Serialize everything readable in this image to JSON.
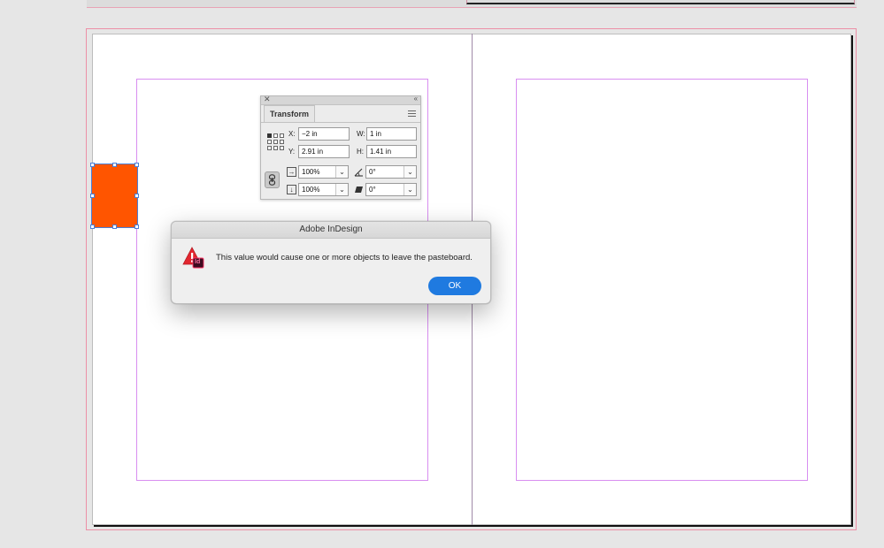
{
  "transform_panel": {
    "tab_label": "Transform",
    "close_glyph": "✕",
    "collapse_glyph": "‹‹",
    "x_label": "X:",
    "x_value": "−2 in",
    "y_label": "Y:",
    "y_value": "2.91 in",
    "w_label": "W:",
    "w_value": "1 in",
    "h_label": "H:",
    "h_value": "1.41 in",
    "scale_x_value": "100%",
    "scale_y_value": "100%",
    "rotation_value": "0°",
    "shear_value": "0°",
    "icons": {
      "reference_point": "reference-point-grid-icon",
      "constrain": "chain-link-icon",
      "scale_x": "scale-x-icon",
      "scale_y": "scale-y-icon",
      "rotate": "rotation-angle-icon",
      "shear": "shear-angle-icon",
      "menu": "panel-menu-icon"
    }
  },
  "alert": {
    "title": "Adobe InDesign",
    "message": "This value would cause one or more objects to leave the pasteboard.",
    "ok_label": "OK",
    "icon": "warning-triangle-icon",
    "badge_text": "Id"
  },
  "colors": {
    "selected_object_fill": "#ff5500",
    "margin_guide": "#d88ef0",
    "bleed_guide": "#ec8fa6",
    "ok_button": "#1f7ae0",
    "selection_handle": "#4a7fd6"
  }
}
